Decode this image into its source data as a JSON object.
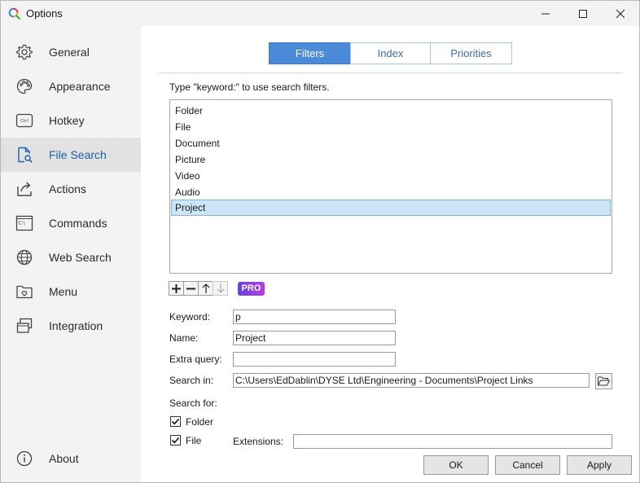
{
  "window": {
    "title": "Options"
  },
  "sidebar": {
    "items": [
      {
        "label": "General"
      },
      {
        "label": "Appearance"
      },
      {
        "label": "Hotkey",
        "icon_text": "Ctrl"
      },
      {
        "label": "File Search"
      },
      {
        "label": "Actions"
      },
      {
        "label": "Commands",
        "icon_text": "C:\\"
      },
      {
        "label": "Web Search"
      },
      {
        "label": "Menu"
      },
      {
        "label": "Integration"
      }
    ],
    "about": {
      "label": "About"
    },
    "selected": "File Search"
  },
  "tabs": [
    {
      "label": "Filters"
    },
    {
      "label": "Index"
    },
    {
      "label": "Priorities"
    }
  ],
  "filters": {
    "hint": "Type \"keyword:\" to use search filters.",
    "list": [
      "Folder",
      "File",
      "Document",
      "Picture",
      "Video",
      "Audio",
      "Project"
    ],
    "selected": "Project",
    "pro_badge": "PRO",
    "form": {
      "keyword_label": "Keyword:",
      "keyword_value": "p",
      "name_label": "Name:",
      "name_value": "Project",
      "extra_query_label": "Extra query:",
      "extra_query_value": "",
      "search_in_label": "Search in:",
      "search_in_value": "C:\\Users\\EdDablin\\DYSE Ltd\\Engineering - Documents\\Project Links",
      "search_for_label": "Search for:",
      "folder_label": "Folder",
      "folder_checked": true,
      "file_label": "File",
      "file_checked": true,
      "extensions_label": "Extensions:",
      "extensions_value": ""
    }
  },
  "buttons": {
    "ok": "OK",
    "cancel": "Cancel",
    "apply": "Apply"
  },
  "colors": {
    "accent": "#4a8ad8",
    "selection": "#cde6f7",
    "pro_start": "#6b3fe0",
    "pro_end": "#b43fe0"
  }
}
